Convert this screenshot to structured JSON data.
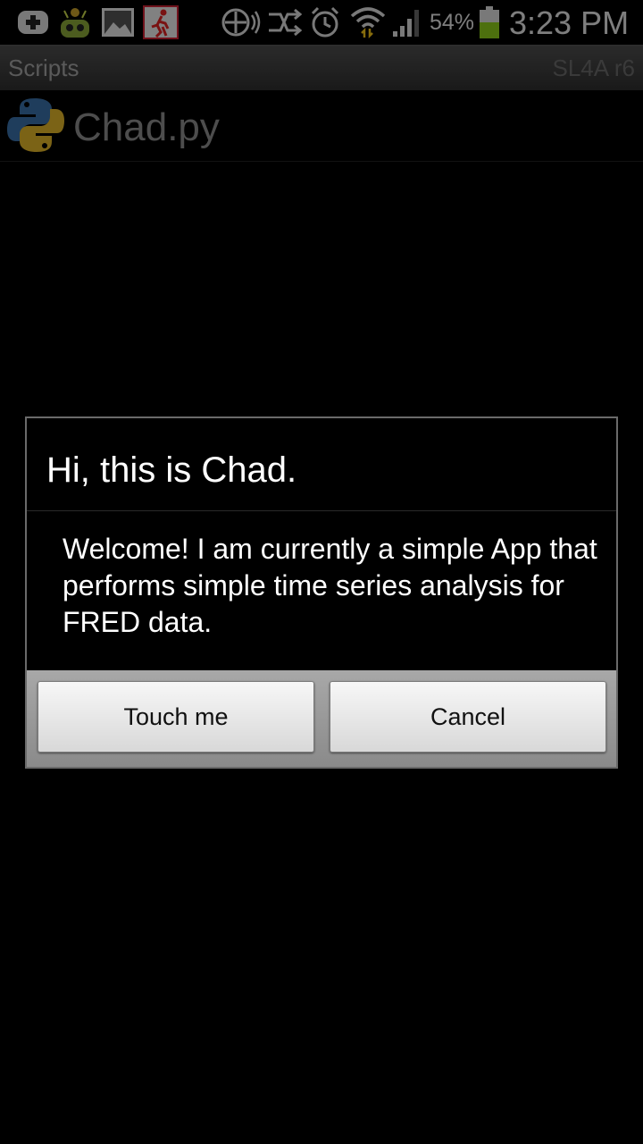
{
  "status_bar": {
    "icons": [
      "add-notification-icon",
      "android-icon",
      "gallery-icon",
      "runner-icon",
      "dpad-icon",
      "sync-icon",
      "alarm-icon",
      "wifi-icon",
      "signal-icon",
      "battery-icon"
    ],
    "battery_percent": "54%",
    "time": "3:23 PM",
    "battery_color": "#8ccc1a"
  },
  "title_bar": {
    "title": "Scripts",
    "version": "SL4A r6"
  },
  "script_list": {
    "items": [
      {
        "name": "Chad.py",
        "icon": "python-icon"
      }
    ]
  },
  "dialog": {
    "title": "Hi, this is Chad.",
    "message": "Welcome! I am currently a simple App that performs simple time series analysis for FRED data.",
    "buttons": {
      "positive": "Touch me",
      "negative": "Cancel"
    }
  }
}
